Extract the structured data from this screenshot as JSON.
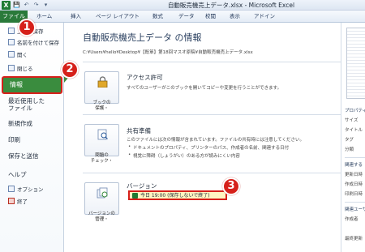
{
  "window": {
    "title": "自動販売機売上データ.xlsx - Microsoft Excel",
    "app_icon": "X"
  },
  "qat": {
    "save": "💾",
    "undo": "↶",
    "redo": "↷",
    "more": "▾"
  },
  "ribbon": {
    "file_tab": "ファイル",
    "tabs": [
      "ホーム",
      "挿入",
      "ページ レイアウト",
      "数式",
      "データ",
      "校閲",
      "表示",
      "アドイン"
    ]
  },
  "nav": {
    "save": "上書き保存",
    "save_as": "名前を付けて保存",
    "open": "開く",
    "close": "閉じる",
    "info": "情報",
    "recent": "最近使用した\nファイル",
    "new": "新規作成",
    "print": "印刷",
    "save_send": "保存と送信",
    "help": "ヘルプ",
    "options": "オプション",
    "exit": "終了"
  },
  "markers": {
    "one": "1",
    "two": "2",
    "three": "3"
  },
  "info": {
    "title": "自動販売機売上データ の情報",
    "path": "C:¥Users¥hello¥Desktop¥【既箪】第18回マスオ原稿¥自動販売機売上データ.xlsx",
    "permissions": {
      "button_label": "ブックの\n保護・",
      "heading": "アクセス許可",
      "description": "すべてのユーザーがこのブックを開いてコピーや変更を行うことができます。"
    },
    "prepare": {
      "button_label": "問題の\nチェック・",
      "heading": "共有準備",
      "description": "このファイルには次の情報が含まれています。ファイルの共有時には注意してください。",
      "bullets": [
        "ドキュメントのプロパティ、プリンターのパス、作成者の名前、関連する日付",
        "視覚に障碍（しょうがい）のある方が読みにくい内容"
      ]
    },
    "versions": {
      "button_label": "バージョンの\n管理・",
      "heading": "バージョン",
      "item": "今日 19:00 (保存しないで終了)"
    }
  },
  "right_panel": {
    "properties_heading": "プロパティ",
    "labels": [
      "サイズ",
      "タイトル",
      "タグ",
      "分類"
    ],
    "related_dates_heading": "関連する",
    "dates": [
      "更新日時",
      "作成日時",
      "印刷日時"
    ],
    "related_people_heading": "関連ユーザー",
    "people": [
      "作成者",
      "最終更新"
    ]
  },
  "colors": {
    "file_tab": "#2a7a3a",
    "active_nav": "#3a8c3e",
    "marker": "#d6201a",
    "highlight": "#fff5c2"
  }
}
